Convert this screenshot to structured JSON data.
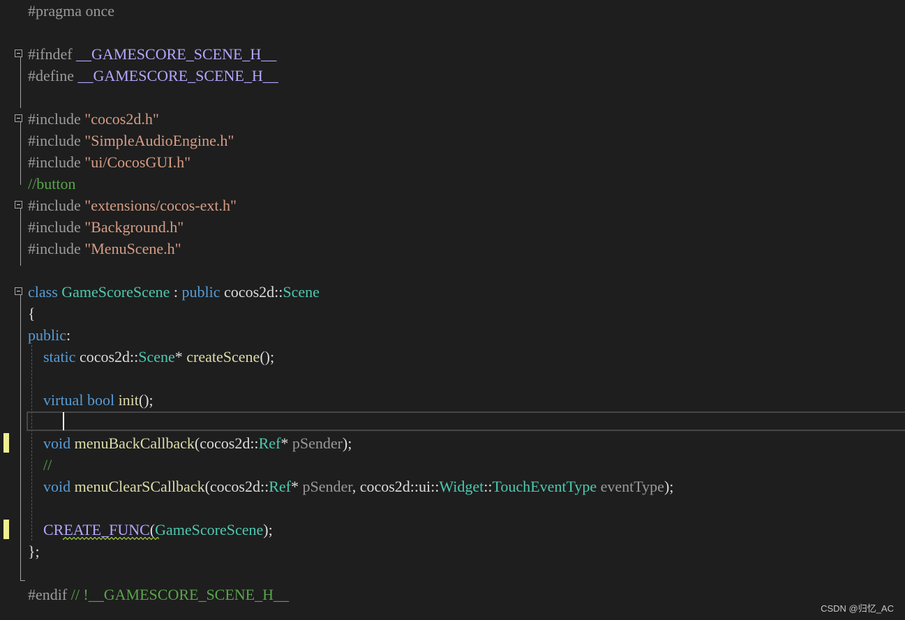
{
  "editor": {
    "lines": [
      [
        {
          "t": "#pragma once",
          "c": "pp"
        }
      ],
      [],
      [
        {
          "t": "#ifndef ",
          "c": "pp"
        },
        {
          "t": "__GAMESCORE_SCENE_H__",
          "c": "mac2"
        }
      ],
      [
        {
          "t": "#define ",
          "c": "pp"
        },
        {
          "t": "__GAMESCORE_SCENE_H__",
          "c": "mac2"
        }
      ],
      [],
      [
        {
          "t": "#include ",
          "c": "pp"
        },
        {
          "t": "\"cocos2d.h\"",
          "c": "str"
        }
      ],
      [
        {
          "t": "#include ",
          "c": "pp"
        },
        {
          "t": "\"SimpleAudioEngine.h\"",
          "c": "str"
        }
      ],
      [
        {
          "t": "#include ",
          "c": "pp"
        },
        {
          "t": "\"ui/CocosGUI.h\"",
          "c": "str"
        }
      ],
      [
        {
          "t": "//button",
          "c": "com"
        }
      ],
      [
        {
          "t": "#include ",
          "c": "pp"
        },
        {
          "t": "\"extensions/cocos-ext.h\"",
          "c": "str"
        }
      ],
      [
        {
          "t": "#include ",
          "c": "pp"
        },
        {
          "t": "\"Background.h\"",
          "c": "str"
        }
      ],
      [
        {
          "t": "#include ",
          "c": "pp"
        },
        {
          "t": "\"MenuScene.h\"",
          "c": "str"
        }
      ],
      [],
      [
        {
          "t": "class",
          "c": "kw"
        },
        {
          "t": " ",
          "c": "txt"
        },
        {
          "t": "GameScoreScene",
          "c": "typ"
        },
        {
          "t": " : ",
          "c": "txt"
        },
        {
          "t": "public",
          "c": "kw"
        },
        {
          "t": " cocos2d::",
          "c": "txt"
        },
        {
          "t": "Scene",
          "c": "typ"
        }
      ],
      [
        {
          "t": "{",
          "c": "txt"
        }
      ],
      [
        {
          "t": "public",
          "c": "kw"
        },
        {
          "t": ":",
          "c": "txt"
        }
      ],
      [
        {
          "t": "    ",
          "c": "txt"
        },
        {
          "t": "static",
          "c": "kw"
        },
        {
          "t": " cocos2d::",
          "c": "txt"
        },
        {
          "t": "Scene",
          "c": "typ"
        },
        {
          "t": "* ",
          "c": "txt"
        },
        {
          "t": "createScene",
          "c": "fn"
        },
        {
          "t": "();",
          "c": "txt"
        }
      ],
      [],
      [
        {
          "t": "    ",
          "c": "txt"
        },
        {
          "t": "virtual",
          "c": "kw"
        },
        {
          "t": " ",
          "c": "txt"
        },
        {
          "t": "bool",
          "c": "kw"
        },
        {
          "t": " ",
          "c": "txt"
        },
        {
          "t": "init",
          "c": "fn"
        },
        {
          "t": "();",
          "c": "txt"
        }
      ],
      [],
      [
        {
          "t": "    ",
          "c": "txt"
        },
        {
          "t": "void",
          "c": "kw"
        },
        {
          "t": " ",
          "c": "txt"
        },
        {
          "t": "menuBackCallback",
          "c": "fn"
        },
        {
          "t": "(cocos2d::",
          "c": "txt"
        },
        {
          "t": "Ref",
          "c": "typ"
        },
        {
          "t": "* ",
          "c": "txt"
        },
        {
          "t": "pSender",
          "c": "par"
        },
        {
          "t": ");",
          "c": "txt"
        }
      ],
      [
        {
          "t": "    ",
          "c": "txt"
        },
        {
          "t": "//",
          "c": "com"
        }
      ],
      [
        {
          "t": "    ",
          "c": "txt"
        },
        {
          "t": "void",
          "c": "kw"
        },
        {
          "t": " ",
          "c": "txt"
        },
        {
          "t": "menuClearSCallback",
          "c": "fn"
        },
        {
          "t": "(cocos2d::",
          "c": "txt"
        },
        {
          "t": "Ref",
          "c": "typ"
        },
        {
          "t": "* ",
          "c": "txt"
        },
        {
          "t": "pSender",
          "c": "par"
        },
        {
          "t": ", cocos2d::ui::",
          "c": "txt"
        },
        {
          "t": "Widget",
          "c": "typ"
        },
        {
          "t": "::",
          "c": "txt"
        },
        {
          "t": "TouchEventType",
          "c": "typ"
        },
        {
          "t": " ",
          "c": "txt"
        },
        {
          "t": "eventType",
          "c": "par"
        },
        {
          "t": ");",
          "c": "txt"
        }
      ],
      [],
      [
        {
          "t": "    ",
          "c": "txt"
        },
        {
          "t": "CREATE_FUNC",
          "c": "mac2"
        },
        {
          "t": "(",
          "c": "txt"
        },
        {
          "t": "GameScoreScene",
          "c": "typ"
        },
        {
          "t": ");",
          "c": "txt"
        }
      ],
      [
        {
          "t": "};",
          "c": "txt"
        }
      ],
      [],
      [
        {
          "t": "#endif ",
          "c": "pp"
        },
        {
          "t": "// !__GAMESCORE_SCENE_H__",
          "c": "com"
        }
      ]
    ]
  },
  "watermark": "CSDN @归忆_AC",
  "colors": {
    "background": "#1e1e1e",
    "keyword": "#569cd6",
    "type": "#4ec9b0",
    "function": "#dcdcaa",
    "string": "#d69d85",
    "comment": "#57a64a",
    "macro": "#b4a7ff",
    "change_marker": "#efef91"
  },
  "icons": [
    "collapse-icon"
  ]
}
